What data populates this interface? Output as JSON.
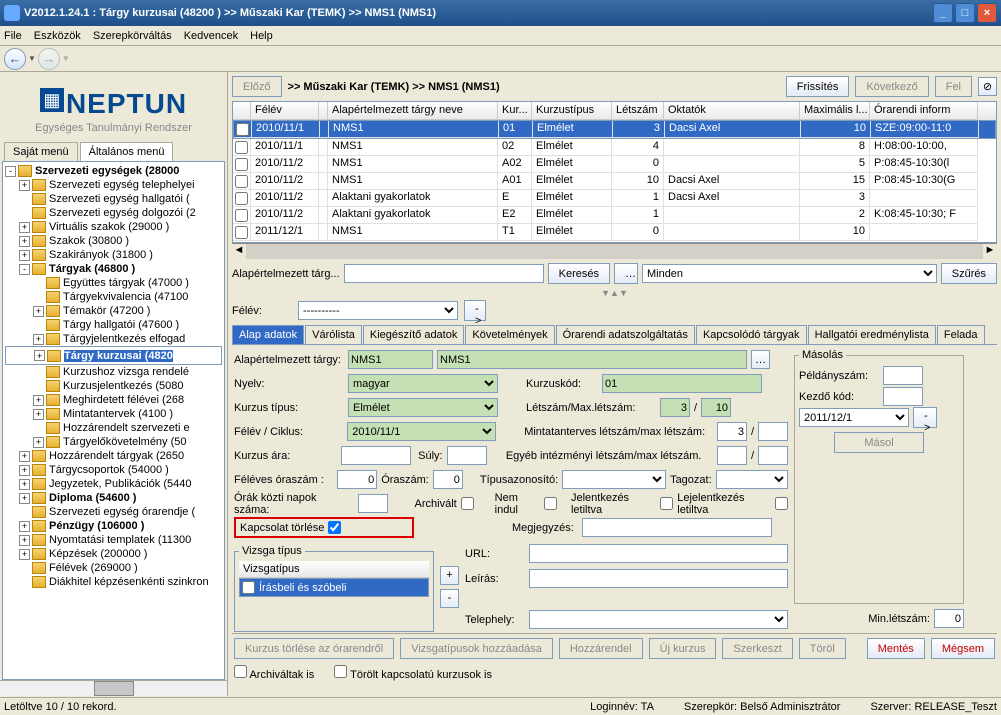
{
  "title": "V2012.1.24.1 : Tárgy kurzusai (48200  )   >> Műszaki Kar (TEMK) >> NMS1 (NMS1)",
  "menu": [
    "File",
    "Eszközök",
    "Szerepkörváltás",
    "Kedvencek",
    "Help"
  ],
  "logo_brand": "NEPTUN",
  "logo_sub": "Egységes Tanulmányi Rendszer",
  "left_tabs": [
    "Saját menü",
    "Általános menü"
  ],
  "tree": [
    {
      "d": 0,
      "e": "-",
      "b": true,
      "l": "Szervezeti egységek (28000"
    },
    {
      "d": 1,
      "e": "+",
      "l": "Szervezeti egység telephelyei"
    },
    {
      "d": 1,
      "e": "",
      "l": "Szervezeti egység hallgatói ("
    },
    {
      "d": 1,
      "e": "",
      "l": "Szervezeti egység dolgozói (2"
    },
    {
      "d": 1,
      "e": "+",
      "l": "Virtuális szakok (29000   )"
    },
    {
      "d": 1,
      "e": "+",
      "l": "Szakok (30800   )"
    },
    {
      "d": 1,
      "e": "+",
      "l": "Szakirányok (31800   )"
    },
    {
      "d": 1,
      "e": "-",
      "b": true,
      "l": "Tárgyak (46800   )"
    },
    {
      "d": 2,
      "e": "",
      "l": "Együttes tárgyak (47000   )"
    },
    {
      "d": 2,
      "e": "",
      "l": "Tárgyekvivalencia (47100"
    },
    {
      "d": 2,
      "e": "+",
      "l": "Témakör (47200   )"
    },
    {
      "d": 2,
      "e": "",
      "l": "Tárgy hallgatói (47600   )"
    },
    {
      "d": 2,
      "e": "+",
      "l": "Tárgyjelentkezés elfogad"
    },
    {
      "d": 2,
      "e": "+",
      "b": true,
      "sel": true,
      "l": "Tárgy kurzusai (4820"
    },
    {
      "d": 2,
      "e": "",
      "l": "Kurzushoz vizsga rendelé"
    },
    {
      "d": 2,
      "e": "",
      "l": "Kurzusjelentkezés (5080"
    },
    {
      "d": 2,
      "e": "+",
      "l": "Meghirdetett félévei (268"
    },
    {
      "d": 2,
      "e": "+",
      "l": "Mintatantervek (4100   )"
    },
    {
      "d": 2,
      "e": "",
      "l": "Hozzárendelt szervezeti e"
    },
    {
      "d": 2,
      "e": "+",
      "l": "Tárgyelőkövetelmény (50"
    },
    {
      "d": 1,
      "e": "+",
      "l": "Hozzárendelt tárgyak (2650  "
    },
    {
      "d": 1,
      "e": "+",
      "l": "Tárgycsoportok (54000   )"
    },
    {
      "d": 1,
      "e": "+",
      "l": "Jegyzetek, Publikációk (5440"
    },
    {
      "d": 1,
      "e": "+",
      "b": true,
      "l": "Diploma (54600   )"
    },
    {
      "d": 1,
      "e": "",
      "l": "Szervezeti egység órarendje ("
    },
    {
      "d": 1,
      "e": "+",
      "b": true,
      "l": "Pénzügy (106000   )"
    },
    {
      "d": 1,
      "e": "+",
      "l": "Nyomtatási templatek (11300"
    },
    {
      "d": 1,
      "e": "+",
      "l": "Képzések (200000   )"
    },
    {
      "d": 1,
      "e": "",
      "l": "Félévek (269000   )"
    },
    {
      "d": 1,
      "e": "",
      "l": "Diákhitel képzésenkénti szinkron"
    }
  ],
  "top_buttons": {
    "prev": "Előző",
    "refresh": "Frissítés",
    "next": "Következő",
    "up": "Fel"
  },
  "breadcrumb": ">> Műszaki Kar (TEMK) >> NMS1 (NMS1)",
  "grid_cols": [
    {
      "l": "",
      "w": 18
    },
    {
      "l": "Félév",
      "w": 68
    },
    {
      "l": "",
      "w": 8
    },
    {
      "l": "Alapértelmezett tárgy neve",
      "w": 170
    },
    {
      "l": "Kur...",
      "w": 34
    },
    {
      "l": "Kurzustípus",
      "w": 80
    },
    {
      "l": "Létszám",
      "w": 52
    },
    {
      "l": "Oktatók",
      "w": 136
    },
    {
      "l": "Maximális l...",
      "w": 70
    },
    {
      "l": "Órarendi inform",
      "w": 108
    }
  ],
  "grid_rows": [
    {
      "sel": true,
      "c": [
        "",
        "2010/11/1",
        "",
        "NMS1",
        "01",
        "Elmélet",
        "3",
        "Dacsi Axel",
        "10",
        "SZE:09:00-11:0"
      ]
    },
    {
      "c": [
        "",
        "2010/11/1",
        "",
        "NMS1",
        "02",
        "Elmélet",
        "4",
        "",
        "8",
        "H:08:00-10:00,"
      ]
    },
    {
      "c": [
        "",
        "2010/11/2",
        "",
        "NMS1",
        "A02",
        "Elmélet",
        "0",
        "",
        "5",
        "P:08:45-10:30(l"
      ]
    },
    {
      "c": [
        "",
        "2010/11/2",
        "",
        "NMS1",
        "A01",
        "Elmélet",
        "10",
        "Dacsi Axel",
        "15",
        "P:08:45-10:30(G"
      ]
    },
    {
      "c": [
        "",
        "2010/11/2",
        "",
        "Alaktani gyakorlatok",
        "E",
        "Elmélet",
        "1",
        "Dacsi Axel",
        "3",
        ""
      ]
    },
    {
      "c": [
        "",
        "2010/11/2",
        "",
        "Alaktani gyakorlatok",
        "E2",
        "Elmélet",
        "1",
        "",
        "2",
        "K:08:45-10:30; F"
      ]
    },
    {
      "c": [
        "",
        "2011/12/1",
        "",
        "NMS1",
        "T1",
        "Elmélet",
        "0",
        "",
        "10",
        ""
      ]
    }
  ],
  "filter": {
    "lbl": "Alapértelmezett tárg...",
    "search": "Keresés",
    "all": "Minden",
    "filt": "Szűrés"
  },
  "felev_lbl": "Félév:",
  "felev_val": "----------",
  "tabs2": [
    "Alap adatok",
    "Várólista",
    "Kiegészítő adatok",
    "Követelmények",
    "Órarendi adatszolgáltatás",
    "Kapcsolódó tárgyak",
    "Hallgatói eredménylista",
    "Felada"
  ],
  "form": {
    "alap_lbl": "Alapértelmezett tárgy:",
    "alap_v1": "NMS1",
    "alap_v2": "NMS1",
    "nyelv_lbl": "Nyelv:",
    "nyelv_v": "magyar",
    "kurzuskod_lbl": "Kurzuskód:",
    "kurzuskod_v": "01",
    "ktip_lbl": "Kurzus típus:",
    "ktip_v": "Elmélet",
    "letmax_lbl": "Létszám/Max.létszám:",
    "let_v": "3",
    "max_v": "10",
    "fcik_lbl": "Félév / Ciklus:",
    "fcik_v": "2010/11/1",
    "minta_lbl": "Mintatanterves létszám/max létszám:",
    "minta_v": "3",
    "kara_lbl": "Kurzus ára:",
    "suly_lbl": "Súly:",
    "egyeb_lbl": "Egyéb intézményi létszám/max létszám.",
    "for_lbl": "Féléves óraszám :",
    "for_v": "0",
    "ora_lbl": "Óraszám:",
    "ora_v": "0",
    "tipaz_lbl": "Típusazonosító:",
    "tag_lbl": "Tagozat:",
    "onk_lbl": "Órák közti napok száma:",
    "arch_lbl": "Archivált",
    "nemind_lbl": "Nem indul",
    "jelt_lbl": "Jelentkezés letiltva",
    "lejt_lbl": "Lejelentkezés letiltva",
    "minl_lbl": "Min.létszám:",
    "minl_v": "0",
    "kapcs_lbl": "Kapcsolat törlése",
    "meg_lbl": "Megjegyzés:",
    "url_lbl": "URL:",
    "leir_lbl": "Leírás:",
    "tel_lbl": "Telephely:",
    "vt_leg": "Vizsga típus",
    "vt_hdr": "Vizsgatípus",
    "vt_row": "Írásbeli és szóbeli"
  },
  "copy": {
    "leg": "Másolás",
    "peld": "Példányszám:",
    "kezd": "Kezdő kód:",
    "fel": "2011/12/1",
    "btn": "Másol"
  },
  "btns": {
    "kurzt": "Kurzus törlése az órarendről",
    "vizsg": "Vizsgatípusok hozzáadása",
    "hozz": "Hozzárendel",
    "uj": "Új kurzus",
    "szerk": "Szerkeszt",
    "torol": "Töröl",
    "ment": "Mentés",
    "megs": "Mégsem"
  },
  "chks": {
    "arch": "Archiváltak is",
    "torolt": "Törölt kapcsolatú kurzusok is"
  },
  "status": {
    "rec": "Letöltve 10 / 10 rekord.",
    "login": "Loginnév: TA",
    "role": "Szerepkör: Belső Adminisztrátor",
    "srv": "Szerver: RELEASE_Teszt"
  }
}
